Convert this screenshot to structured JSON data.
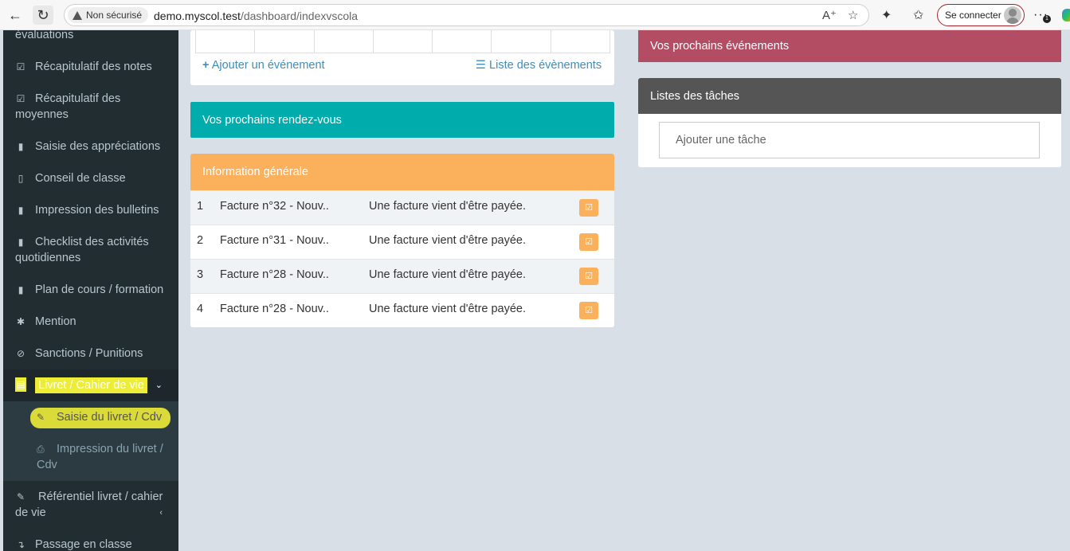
{
  "browser": {
    "security_label": "Non sécurisé",
    "url_host": "demo.myscol.test",
    "url_path": "/dashboard/indexvscola",
    "connect_label": "Se connecter",
    "notification_count": "1"
  },
  "sidebar": {
    "items": [
      {
        "label": "évaluations",
        "icon": "none"
      },
      {
        "label": "Récapitulatif des notes",
        "icon": "check-square-icon"
      },
      {
        "label": "Récapitulatif des moyennes",
        "icon": "check-square-icon"
      },
      {
        "label": "Saisie des appréciations",
        "icon": "file-icon"
      },
      {
        "label": "Conseil de classe",
        "icon": "file-outline-icon"
      },
      {
        "label": "Impression des bulletins",
        "icon": "file-icon"
      },
      {
        "label": "Checklist des activités quotidiennes",
        "icon": "file-icon"
      },
      {
        "label": "Plan de cours / formation",
        "icon": "file-icon"
      },
      {
        "label": "Mention",
        "icon": "asterisk-icon"
      },
      {
        "label": "Sanctions / Punitions",
        "icon": "ban-icon"
      },
      {
        "label": "Livret / Cahier de vie",
        "icon": "file-text-icon"
      },
      {
        "label": "Référentiel livret / cahier de vie",
        "icon": "edit-icon"
      },
      {
        "label": "Passage en classe",
        "icon": "level-icon"
      }
    ],
    "submenu": [
      {
        "label": "Saisie du livret / Cdv",
        "icon": "pencil-icon"
      },
      {
        "label": "Impression du livret / Cdv",
        "icon": "print-icon"
      }
    ]
  },
  "calendar": {
    "add_event": "Ajouter un événement",
    "event_list": "Liste des évènements"
  },
  "appointments": {
    "title": "Vos prochains rendez-vous"
  },
  "info": {
    "title": "Information générale",
    "rows": [
      {
        "num": "1",
        "title": "Facture n°32 - Nouv..",
        "desc": "Une facture vient d'être payée."
      },
      {
        "num": "2",
        "title": "Facture n°31 - Nouv..",
        "desc": "Une facture vient d'être payée."
      },
      {
        "num": "3",
        "title": "Facture n°28 - Nouv..",
        "desc": "Une facture vient d'être payée."
      },
      {
        "num": "4",
        "title": "Facture n°28 - Nouv..",
        "desc": "Une facture vient d'être payée."
      }
    ]
  },
  "events": {
    "title": "Vos prochains événements"
  },
  "tasks": {
    "title": "Listes des tâches",
    "placeholder": "Ajouter une tâche"
  },
  "colors": {
    "sidebar_bg": "#222d32",
    "teal": "#00acac",
    "orange": "#fbb05c",
    "rose": "#b34d63",
    "dark_gray": "#555555",
    "link": "#3c8dbc",
    "highlight": "#eded37"
  }
}
